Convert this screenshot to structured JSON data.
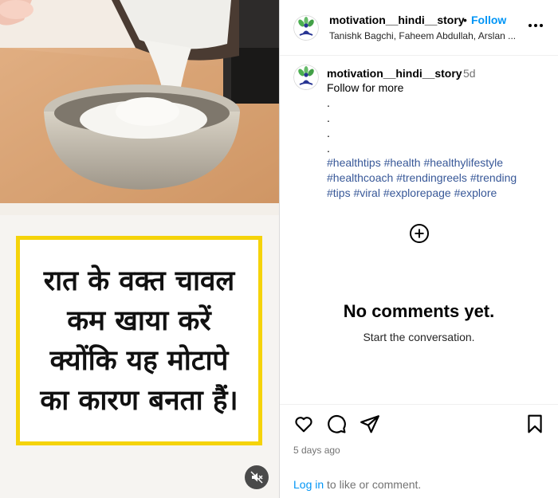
{
  "colors": {
    "accent": "#0095f6",
    "caption_border": "#f5d30a",
    "hashtag": "#385898",
    "muted_text": "#737373"
  },
  "media": {
    "overlay_text_lines": [
      "रात के वक्त चावल",
      "कम खाया करें",
      "क्योंकि यह मोटापे",
      "का कारण बनता हैं।"
    ],
    "mute_icon": "speaker-muted-icon"
  },
  "header": {
    "username": "motivation__hindi__story",
    "separator": "•",
    "follow_label": "Follow",
    "collaborators": "Tanishk Bagchi, Faheem Abdullah, Arslan ...",
    "more_icon": "more-options-icon"
  },
  "caption": {
    "username": "motivation__hindi__story",
    "time": "5d",
    "text": "Follow for more",
    "dots": [
      ".",
      ".",
      ".",
      "."
    ],
    "hashtags": [
      "#healthtips",
      "#health",
      "#healthylifestyle",
      "#healthcoach",
      "#trendingreels",
      "#trending",
      "#tips",
      "#viral",
      "#explorepage",
      "#explore"
    ]
  },
  "comments": {
    "empty_title": "No comments yet.",
    "empty_subtitle": "Start the conversation."
  },
  "actions": {
    "icons": [
      "heart-icon",
      "comment-icon",
      "share-icon",
      "bookmark-icon"
    ],
    "posted": "5 days ago",
    "login_link": "Log in",
    "login_suffix": " to like or comment."
  }
}
